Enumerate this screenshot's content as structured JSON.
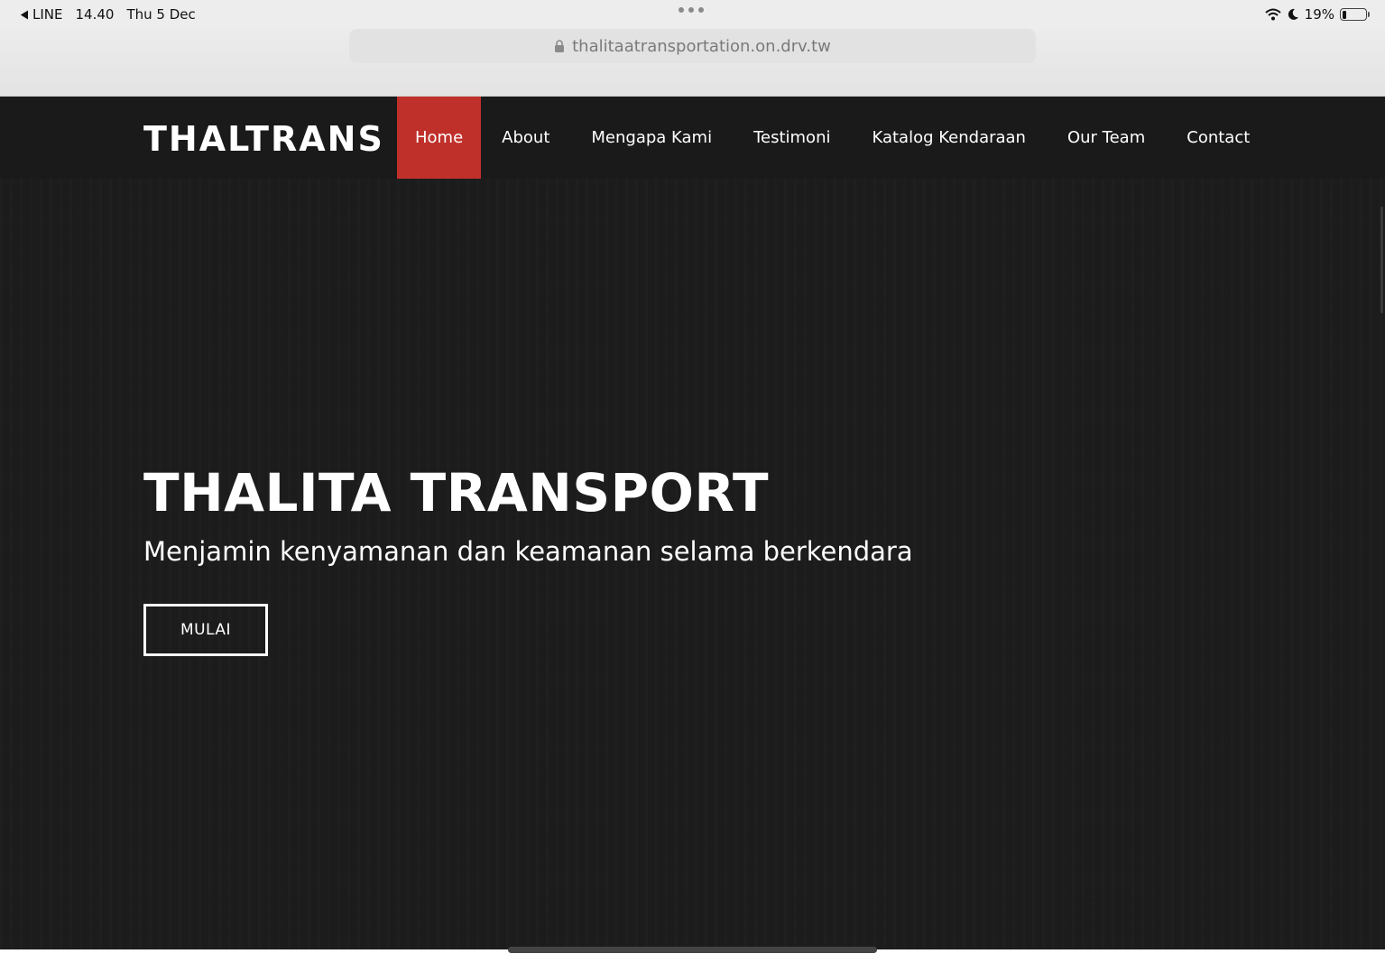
{
  "status_bar": {
    "back_app": "LINE",
    "time": "14.40",
    "date": "Thu 5 Dec",
    "battery": "19%",
    "battery_level": 0.19
  },
  "browser": {
    "url": "thalitaatransportation.on.drv.tw"
  },
  "site": {
    "logo": "THALTRANS",
    "nav": [
      {
        "label": "Home",
        "active": true
      },
      {
        "label": "About"
      },
      {
        "label": "Mengapa Kami"
      },
      {
        "label": "Testimoni"
      },
      {
        "label": "Katalog Kendaraan"
      },
      {
        "label": "Our Team"
      },
      {
        "label": "Contact"
      }
    ],
    "hero": {
      "title": "THALITA TRANSPORT",
      "subtitle": "Menjamin kenyamanan dan keamanan selama berkendara",
      "button": "MULAI"
    }
  },
  "colors": {
    "accent": "#c0302b",
    "background": "#1c1c1c"
  }
}
